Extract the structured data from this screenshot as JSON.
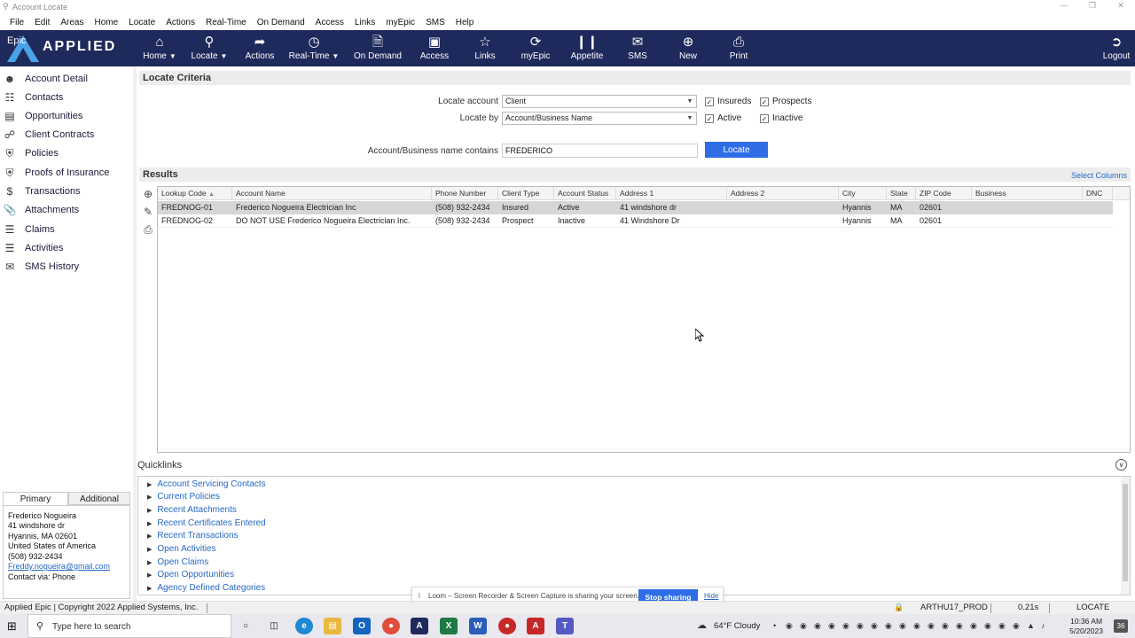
{
  "window": {
    "title": "Account Locate"
  },
  "menu": [
    "File",
    "Edit",
    "Areas",
    "Home",
    "Locate",
    "Actions",
    "Real-Time",
    "On Demand",
    "Access",
    "Links",
    "myEpic",
    "SMS",
    "Help"
  ],
  "brand": {
    "name": "APPLIED",
    "sub": "Epic"
  },
  "toolbar": {
    "home": "Home",
    "locate": "Locate",
    "actions": "Actions",
    "realtime": "Real-Time",
    "ondemand": "On Demand",
    "access": "Access",
    "links": "Links",
    "myepic": "myEpic",
    "appetite": "Appetite",
    "sms": "SMS",
    "new": "New",
    "print": "Print",
    "logout": "Logout"
  },
  "nav": [
    "Account Detail",
    "Contacts",
    "Opportunities",
    "Client Contracts",
    "Policies",
    "Proofs of Insurance",
    "Transactions",
    "Attachments",
    "Claims",
    "Activities",
    "SMS History"
  ],
  "criteria": {
    "title": "Locate Criteria",
    "locate_account_label": "Locate account",
    "locate_account_value": "Client",
    "locate_by_label": "Locate by",
    "locate_by_value": "Account/Business Name",
    "insureds": "Insureds",
    "prospects": "Prospects",
    "active": "Active",
    "inactive": "Inactive",
    "name_contains_label": "Account/Business name contains",
    "name_contains_value": "FREDERICO",
    "locate_button": "Locate"
  },
  "results": {
    "title": "Results",
    "select_columns": "Select Columns",
    "columns": [
      "Lookup Code",
      "Account Name",
      "Phone Number",
      "Client Type",
      "Account Status",
      "Address 1",
      "Address 2",
      "City",
      "State",
      "ZIP Code",
      "Business",
      "DNC"
    ],
    "rows": [
      [
        "FREDNOG-01",
        "Frederico Nogueira Electrician Inc",
        "(508) 932-2434",
        "Insured",
        "Active",
        "41 windshore dr",
        "",
        "Hyannis",
        "MA",
        "02601",
        "",
        ""
      ],
      [
        "FREDNOG-02",
        "DO NOT USE Frederico Nogueira Electrician Inc.",
        "(508) 932-2434",
        "Prospect",
        "Inactive",
        "41 Windshore Dr",
        "",
        "Hyannis",
        "MA",
        "02601",
        "",
        ""
      ]
    ]
  },
  "quicklinks": {
    "title": "Quicklinks",
    "items": [
      "Account Servicing Contacts",
      "Current Policies",
      "Recent Attachments",
      "Recent Certificates Entered",
      "Recent Transactions",
      "Open Activities",
      "Open Claims",
      "Open Opportunities",
      "Agency Defined Categories"
    ]
  },
  "contact_panel": {
    "tabs": [
      "Primary",
      "Additional"
    ],
    "name": "Frederico Nogueira",
    "address1": "41 windshore dr",
    "city_line": "Hyannis, MA  02601",
    "country": "United States of America",
    "phone": "(508) 932-2434",
    "email": "Freddy.nogueira@gmail.com",
    "contact_via": "Contact via: Phone"
  },
  "loom": {
    "message": "Loom – Screen Recorder & Screen Capture is sharing your screen.",
    "stop": "Stop sharing",
    "hide": "Hide"
  },
  "status": {
    "copyright": "Applied Epic | Copyright 2022 Applied Systems, Inc.",
    "user": "ARTHU17_PROD",
    "timing": "0.21s",
    "mode": "LOCATE"
  },
  "taskbar": {
    "search_placeholder": "Type here to search",
    "weather": "64°F  Cloudy",
    "time": "10:36 AM",
    "date": "5/20/2023",
    "notifications": "36"
  }
}
